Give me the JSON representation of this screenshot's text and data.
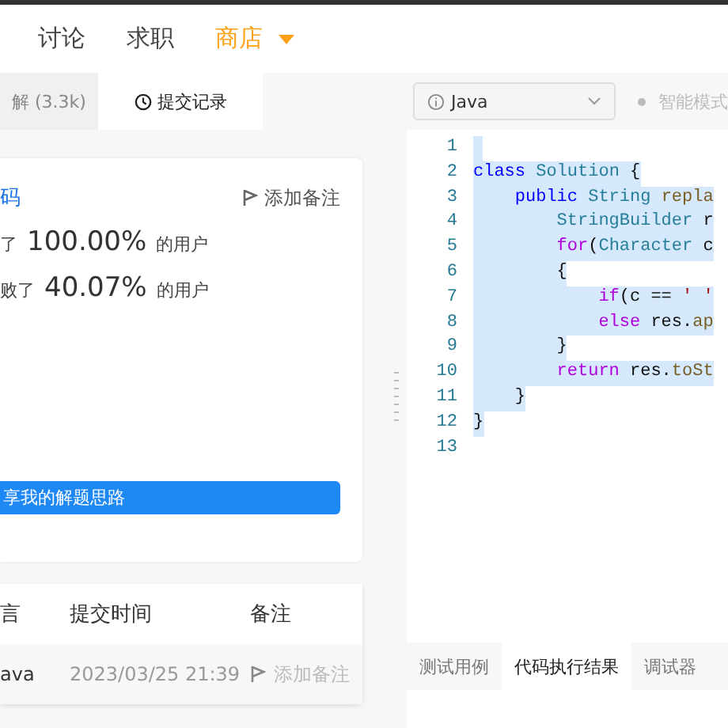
{
  "nav": {
    "items": [
      {
        "label": "讨论",
        "selected": false,
        "dropdown": false
      },
      {
        "label": "求职",
        "selected": false,
        "dropdown": false
      },
      {
        "label": "商店",
        "selected": true,
        "dropdown": true
      }
    ]
  },
  "tabs": [
    {
      "label": "解 (3.3k)",
      "selected": false
    },
    {
      "label": "提交记录",
      "selected": true
    }
  ],
  "result_card": {
    "title": "码",
    "add_note": "添加备注",
    "stats": [
      {
        "prefix": "了",
        "value": "100.00%",
        "suffix": "的用户"
      },
      {
        "prefix": "败了",
        "value": "40.07%",
        "suffix": "的用户"
      }
    ],
    "share_button": "享我的解题思路"
  },
  "submissions": {
    "columns": [
      "言",
      "提交时间",
      "备注"
    ],
    "rows": [
      {
        "language": "ava",
        "time": "2023/03/25 21:39",
        "note": "添加备注"
      }
    ]
  },
  "editor": {
    "language": "Java",
    "mode": "智能模式",
    "lines": [
      {
        "number": "1",
        "selected": true
      },
      {
        "number": "2",
        "selected": true,
        "tokens": [
          {
            "kind": "keyword",
            "text": "class"
          },
          {
            "kind": "type",
            "text": " Solution"
          },
          {
            "kind": "plain",
            "text": " {"
          }
        ],
        "children": [
          {
            "number": "3",
            "selected": true,
            "tokens": [
              {
                "kind": "keyword",
                "text": "public"
              },
              {
                "kind": "type",
                "text": " String"
              },
              {
                "kind": "method",
                "text": " repla"
              }
            ],
            "children": [
              {
                "number": "4",
                "selected": true,
                "tokens": [
                  {
                    "kind": "type",
                    "text": "StringBuilder"
                  },
                  {
                    "kind": "plain",
                    "text": " r"
                  }
                ]
              },
              {
                "number": "5",
                "selected": true,
                "tokens": [
                  {
                    "kind": "control",
                    "text": "for"
                  },
                  {
                    "kind": "plain",
                    "text": "("
                  },
                  {
                    "kind": "type",
                    "text": "Character"
                  },
                  {
                    "kind": "plain",
                    "text": " c"
                  }
                ]
              },
              {
                "number": "6",
                "selected": true,
                "tokens": [
                  {
                    "kind": "plain",
                    "text": "{"
                  }
                ],
                "children": [
                  {
                    "number": "7",
                    "selected": true,
                    "tokens": [
                      {
                        "kind": "control",
                        "text": "if"
                      },
                      {
                        "kind": "plain",
                        "text": "(c =="
                      },
                      {
                        "kind": "string",
                        "text": " ' '"
                      }
                    ]
                  },
                  {
                    "number": "8",
                    "selected": true,
                    "tokens": [
                      {
                        "kind": "control",
                        "text": "else"
                      },
                      {
                        "kind": "plain",
                        "text": " res."
                      },
                      {
                        "kind": "method",
                        "text": "ap"
                      }
                    ]
                  }
                ]
              },
              {
                "number": "9",
                "selected": true,
                "tokens": [
                  {
                    "kind": "plain",
                    "text": "}"
                  }
                ]
              },
              {
                "number": "10",
                "selected": true,
                "tokens": [
                  {
                    "kind": "control",
                    "text": "return"
                  },
                  {
                    "kind": "plain",
                    "text": " res."
                  },
                  {
                    "kind": "method",
                    "text": "toSt"
                  }
                ]
              }
            ]
          },
          {
            "number": "11",
            "selected": true,
            "tokens": [
              {
                "kind": "plain",
                "text": "}"
              }
            ]
          }
        ]
      },
      {
        "number": "12",
        "selected": true,
        "tokens": [
          {
            "kind": "plain",
            "text": "}"
          }
        ]
      },
      {
        "number": "13",
        "selected": false
      }
    ]
  },
  "bottom_tabs": [
    {
      "label": "测试用例",
      "selected": false
    },
    {
      "label": "代码执行结果",
      "selected": true
    },
    {
      "label": "调试器",
      "selected": false
    }
  ]
}
